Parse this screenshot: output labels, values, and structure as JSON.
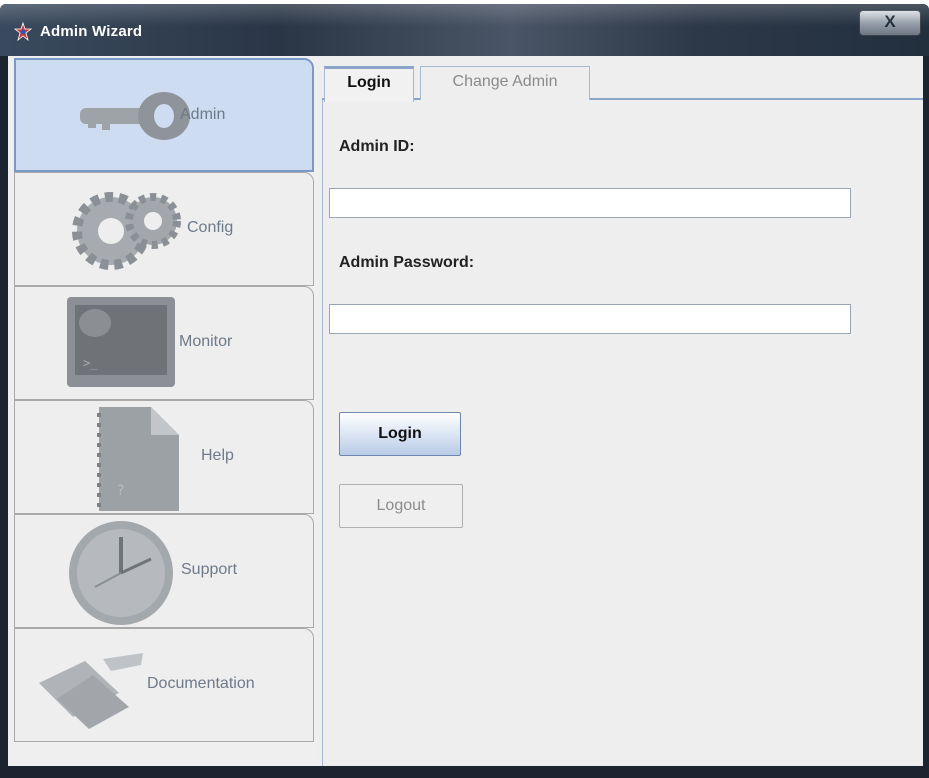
{
  "window": {
    "title": "Admin Wizard",
    "close_label": "X"
  },
  "sidebar": {
    "items": [
      {
        "label": "Admin",
        "icon": "key-icon",
        "active": true
      },
      {
        "label": "Config",
        "icon": "gears-icon",
        "active": false
      },
      {
        "label": "Monitor",
        "icon": "monitor-icon",
        "active": false
      },
      {
        "label": "Help",
        "icon": "document-icon",
        "active": false
      },
      {
        "label": "Support",
        "icon": "clock-icon",
        "active": false
      },
      {
        "label": "Documentation",
        "icon": "papers-icon",
        "active": false
      }
    ]
  },
  "tabs": [
    {
      "label": "Login",
      "selected": true
    },
    {
      "label": "Change Admin",
      "selected": false
    }
  ],
  "form": {
    "admin_id_label": "Admin ID:",
    "admin_id_value": "",
    "admin_password_label": "Admin Password:",
    "admin_password_value": "",
    "login_button": "Login",
    "logout_button": "Logout"
  },
  "colors": {
    "accent": "#8aa3c8",
    "active_nav": "#cddcf0"
  }
}
